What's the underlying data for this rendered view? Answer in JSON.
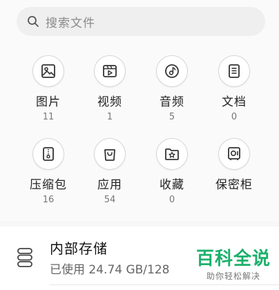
{
  "search": {
    "placeholder": "搜索文件"
  },
  "categories": [
    {
      "label": "图片",
      "count": "11",
      "icon": "image-icon"
    },
    {
      "label": "视频",
      "count": "1",
      "icon": "video-icon"
    },
    {
      "label": "音频",
      "count": "5",
      "icon": "audio-icon"
    },
    {
      "label": "文档",
      "count": "0",
      "icon": "document-icon"
    },
    {
      "label": "压缩包",
      "count": "16",
      "icon": "archive-icon"
    },
    {
      "label": "应用",
      "count": "54",
      "icon": "app-bag-icon"
    },
    {
      "label": "收藏",
      "count": "0",
      "icon": "favorite-folder-icon"
    },
    {
      "label": "保密柜",
      "count": "",
      "icon": "safe-icon"
    }
  ],
  "storage": {
    "title": "内部存储",
    "usage": "已使用 24.74 GB/128",
    "icon": "storage-icon"
  },
  "watermark": {
    "brand": "百科全说",
    "tagline": "助你轻松解决"
  },
  "colors": {
    "background": "#f7f7f7",
    "watermark_green": "#1bb06b",
    "icon_stroke": "#333333"
  }
}
